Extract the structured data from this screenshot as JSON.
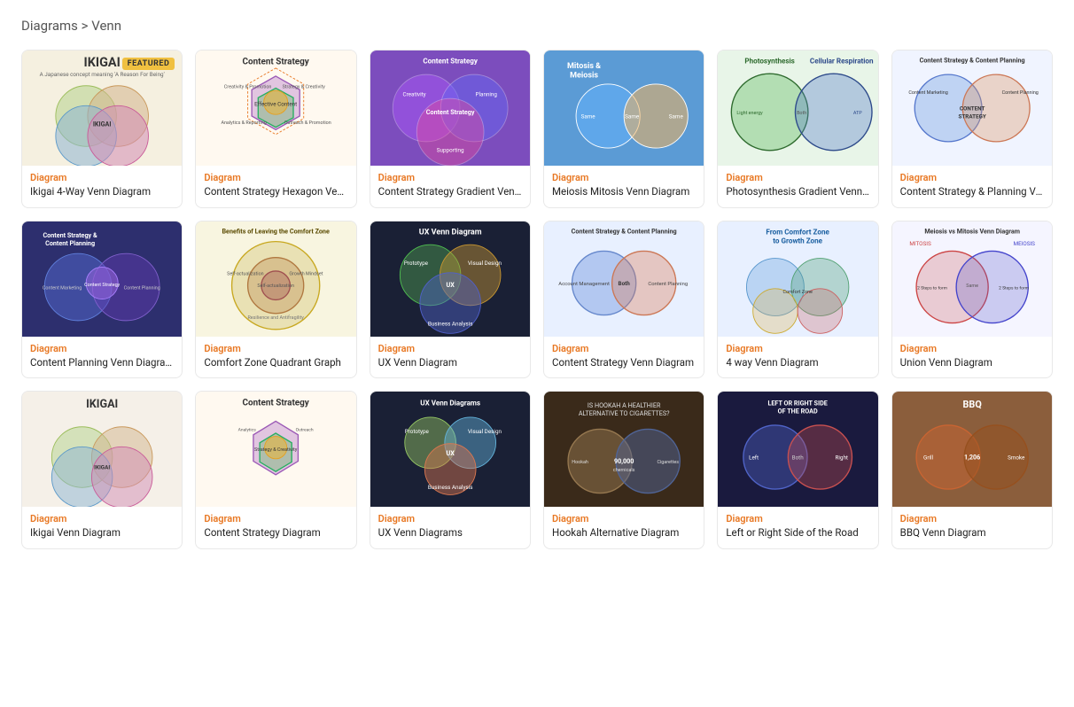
{
  "breadcrumb": {
    "parent": "Diagrams",
    "separator": " > ",
    "current": "Venn"
  },
  "grid": {
    "rows": [
      [
        {
          "id": "ikigai",
          "type": "Diagram",
          "type_color": "orange",
          "title": "Ikigai 4-Way Venn Diagram",
          "featured": true,
          "thumb_class": "thumb-ikigai",
          "thumb_label": "IKIGAI"
        },
        {
          "id": "content-strategy-hex",
          "type": "Diagram",
          "type_color": "orange",
          "title": "Content Strategy Hexagon Venn...",
          "featured": false,
          "thumb_class": "thumb-content-strategy",
          "thumb_label": "Content Strategy"
        },
        {
          "id": "content-gradient",
          "type": "Diagram",
          "type_color": "orange",
          "title": "Content Strategy Gradient Venn...",
          "featured": false,
          "thumb_class": "thumb-content-gradient",
          "thumb_label": "Content Strategy"
        },
        {
          "id": "meiosis",
          "type": "Diagram",
          "type_color": "orange",
          "title": "Meiosis Mitosis Venn Diagram",
          "featured": false,
          "thumb_class": "thumb-meiosis",
          "thumb_label": "Mitosis & Meiosis"
        },
        {
          "id": "photosynthesis",
          "type": "Diagram",
          "type_color": "orange",
          "title": "Photosynthesis Gradient Venn D...",
          "featured": false,
          "thumb_class": "thumb-photosynthesis",
          "thumb_label": "Photosynthesis"
        },
        {
          "id": "content-planning-v",
          "type": "Diagram",
          "type_color": "orange",
          "title": "Content Strategy & Planning Ve...",
          "featured": false,
          "thumb_class": "thumb-content-planning",
          "thumb_label": "Content Strategy & Content Planning"
        }
      ],
      [
        {
          "id": "content-planning2",
          "type": "Diagram",
          "type_color": "orange",
          "title": "Content Planning Venn Diagram",
          "featured": false,
          "thumb_class": "thumb-content-planning2",
          "thumb_label": "Content Strategy & Content Planning"
        },
        {
          "id": "comfort-zone",
          "type": "Diagram",
          "type_color": "orange",
          "title": "Comfort Zone Quadrant Graph",
          "featured": false,
          "thumb_class": "thumb-comfort-zone",
          "thumb_label": "Benefits of Leaving the Comfort Zone"
        },
        {
          "id": "ux-venn",
          "type": "Diagram",
          "type_color": "orange",
          "title": "UX Venn Diagram",
          "featured": false,
          "thumb_class": "thumb-ux-venn",
          "thumb_label": "UX Venn Diagram"
        },
        {
          "id": "content-venn",
          "type": "Diagram",
          "type_color": "orange",
          "title": "Content Strategy Venn Diagram",
          "featured": false,
          "thumb_class": "thumb-content-venn",
          "thumb_label": "Content Strategy & Content Planning"
        },
        {
          "id": "4way-venn",
          "type": "Diagram",
          "type_color": "orange",
          "title": "4 way Venn Diagram",
          "featured": false,
          "thumb_class": "thumb-4way",
          "thumb_label": "From Comfort Zone to Growth Zone"
        },
        {
          "id": "union-venn",
          "type": "Diagram",
          "type_color": "orange",
          "title": "Union Venn Diagram",
          "featured": false,
          "thumb_class": "thumb-union",
          "thumb_label": "Meiosis vs Mitosis Venn Diagram"
        }
      ],
      [
        {
          "id": "row3-1",
          "type": "Diagram",
          "type_color": "orange",
          "title": "Ikigai Venn Diagram",
          "featured": false,
          "thumb_class": "thumb-row3-1",
          "thumb_label": "IKIGAI"
        },
        {
          "id": "row3-2",
          "type": "Diagram",
          "type_color": "orange",
          "title": "Content Strategy Diagram",
          "featured": false,
          "thumb_class": "thumb-row3-2",
          "thumb_label": "Content Strategy"
        },
        {
          "id": "row3-3",
          "type": "Diagram",
          "type_color": "orange",
          "title": "UX Venn Diagrams",
          "featured": false,
          "thumb_class": "thumb-row3-3",
          "thumb_label": "UX Venn Diagrams"
        },
        {
          "id": "row3-4",
          "type": "Diagram",
          "type_color": "orange",
          "title": "Hookah Alternative Diagram",
          "featured": false,
          "thumb_class": "thumb-row3-4",
          "thumb_label": "Is Hookah a Healthier Alternative?"
        },
        {
          "id": "row3-5",
          "type": "Diagram",
          "type_color": "orange",
          "title": "Left or Right Side of the Road",
          "featured": false,
          "thumb_class": "thumb-row3-5",
          "thumb_label": "Left or Right Side of the Road"
        },
        {
          "id": "row3-6",
          "type": "Diagram",
          "type_color": "orange",
          "title": "BBQ Venn Diagram",
          "featured": false,
          "thumb_class": "thumb-row3-6",
          "thumb_label": "1,206"
        }
      ]
    ]
  }
}
